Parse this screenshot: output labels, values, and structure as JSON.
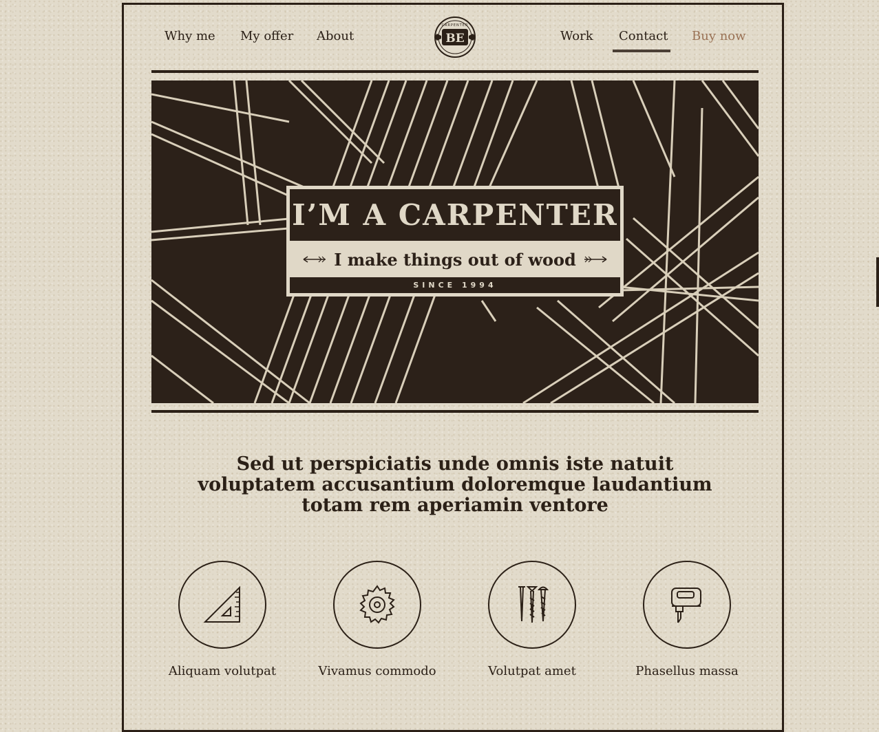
{
  "nav": {
    "left": [
      {
        "label": "Why me"
      },
      {
        "label": "My offer"
      },
      {
        "label": "About"
      }
    ],
    "right": [
      {
        "label": "Work"
      },
      {
        "label": "Contact"
      },
      {
        "label": "Buy now"
      }
    ],
    "active": "Contact"
  },
  "logo": {
    "initials": "BE",
    "ring_text": "CARPENTER",
    "icon": "carpenter-badge-logo"
  },
  "hero": {
    "title": "I’M A CARPENTER",
    "subtitle": "I make things out of wood",
    "since": "SINCE 1994"
  },
  "headline": {
    "line1": "Sed ut perspiciatis unde omnis iste natuit",
    "line2": "voluptatem accusantium doloremque laudantium",
    "line3": "totam rem aperiamin ventore"
  },
  "features": [
    {
      "label": "Aliquam volutpat",
      "icon": "set-square-ruler-icon"
    },
    {
      "label": "Vivamus commodo",
      "icon": "saw-blade-icon"
    },
    {
      "label": "Volutpat amet",
      "icon": "nails-screws-icon"
    },
    {
      "label": "Phasellus massa",
      "icon": "jigsaw-icon"
    }
  ],
  "colors": {
    "background": "#e2dbcb",
    "dark": "#2b2017",
    "accent": "#9a7255",
    "hero": "#2c2119",
    "cream": "#e0d8c7"
  }
}
